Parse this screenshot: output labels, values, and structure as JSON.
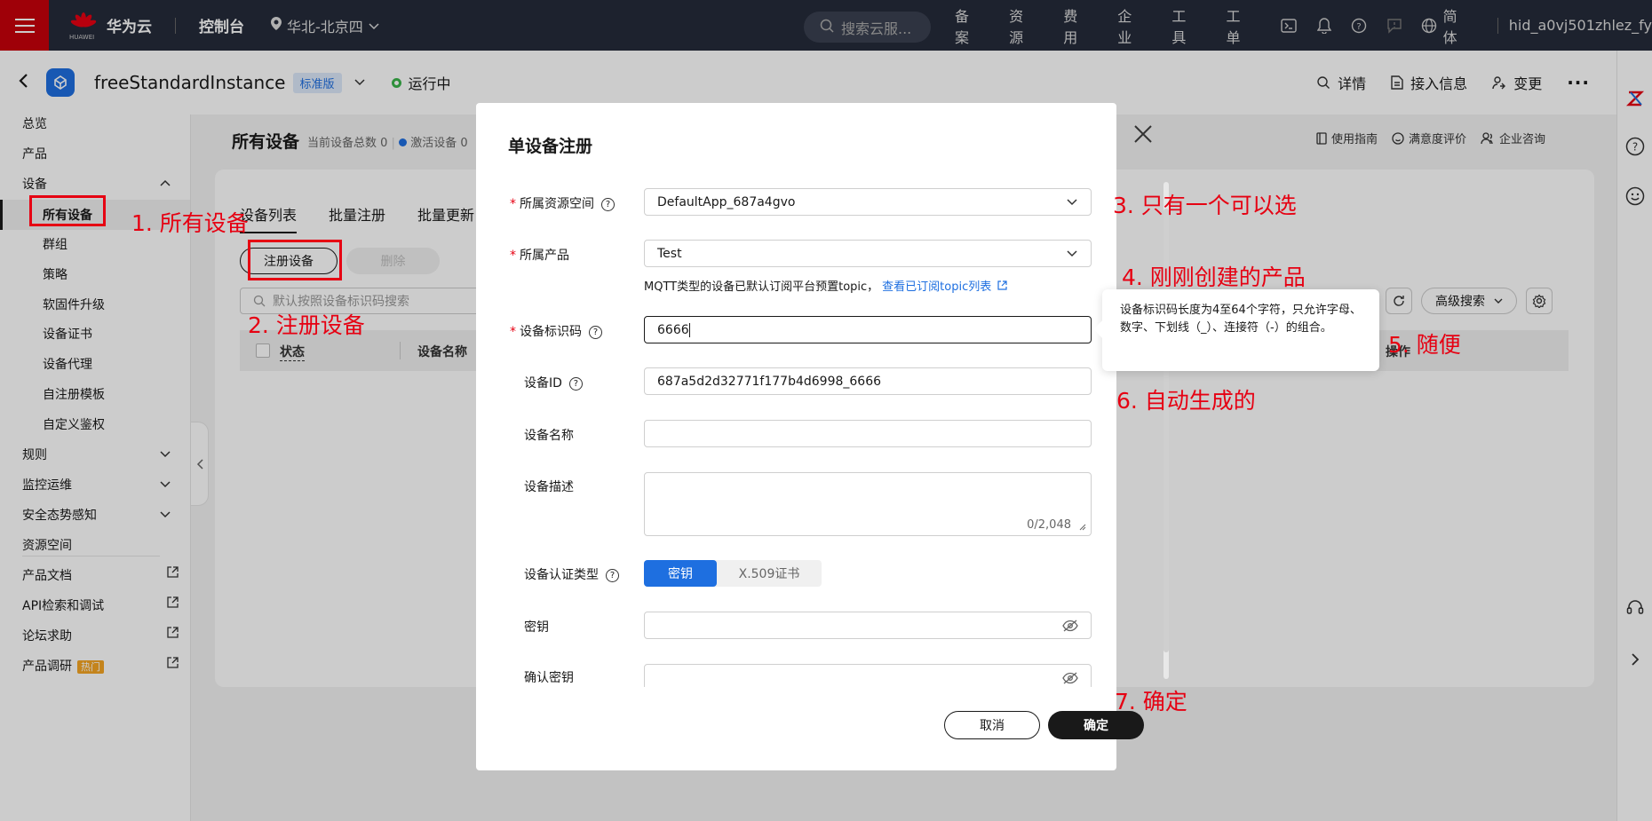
{
  "topbar": {
    "brand": "华为云",
    "brand_sub": "HUAWEI",
    "console": "控制台",
    "region": "华北-北京四",
    "search_placeholder": "搜索云服...",
    "nav": [
      "备案",
      "资源",
      "费用",
      "企业",
      "工具",
      "工单"
    ],
    "language": "简体",
    "user": "hid_a0vj501zhlez_fy"
  },
  "instance": {
    "name": "freeStandardInstance",
    "edition": "标准版",
    "status": "运行中",
    "actions": [
      "详情",
      "接入信息",
      "变更"
    ]
  },
  "sidebar": {
    "items": [
      "总览",
      "产品",
      "设备",
      "所有设备",
      "群组",
      "策略",
      "软固件升级",
      "设备证书",
      "设备代理",
      "自注册模板",
      "自定义鉴权",
      "规则",
      "监控运维",
      "安全态势感知",
      "资源空间",
      "产品文档",
      "API检索和调试",
      "论坛求助",
      "产品调研"
    ],
    "hot_badge": "热门"
  },
  "main": {
    "title": "所有设备",
    "subtitle_total": "当前设备总数 0",
    "subtitle_active": "激活设备 0",
    "right_links": [
      "使用指南",
      "满意度评价",
      "企业咨询"
    ],
    "tabs": [
      "设备列表",
      "批量注册",
      "批量更新"
    ],
    "register_btn": "注册设备",
    "delete_btn": "删除",
    "search_placeholder": "默认按照设备标识码搜索",
    "adv_search": "高级搜索",
    "col_status": "状态",
    "col_name": "设备名称",
    "col_ops": "操作"
  },
  "modal": {
    "title": "单设备注册",
    "resource_space_label": "所属资源空间",
    "resource_space_value": "DefaultApp_687a4gvo",
    "product_label": "所属产品",
    "product_value": "Test",
    "hint_text": "MQTT类型的设备已默认订阅平台预置topic，",
    "hint_link": "查看已订阅topic列表",
    "node_id_label": "设备标识码",
    "node_id_value": "6666",
    "device_id_label": "设备ID",
    "device_id_value": "687a5d2d32771f177b4d6998_6666",
    "device_name_label": "设备名称",
    "device_name_value": "",
    "desc_label": "设备描述",
    "desc_counter": "0/2,048",
    "auth_label": "设备认证类型",
    "auth_secret": "密钥",
    "auth_x509": "X.509证书",
    "secret_label": "密钥",
    "confirm_secret_label": "确认密钥",
    "cancel_btn": "取消",
    "ok_btn": "确定"
  },
  "tooltip": {
    "text": "设备标识码长度为4至64个字符，只允许字母、数字、下划线（_）、连接符（-）的组合。"
  },
  "annotations": {
    "a1": "1. 所有设备",
    "a2": "2. 注册设备",
    "a3": "3. 只有一个可以选",
    "a4": "4. 刚刚创建的产品",
    "a5": "5. 随便",
    "a6": "6. 自动生成的",
    "a7": "7. 确定"
  },
  "colors": {
    "topbar_bg": "#252b3a",
    "brand_red": "#c7000b",
    "accent_blue": "#1e6fe0",
    "annotation_red": "#e60012",
    "status_green": "#3ab54a"
  }
}
